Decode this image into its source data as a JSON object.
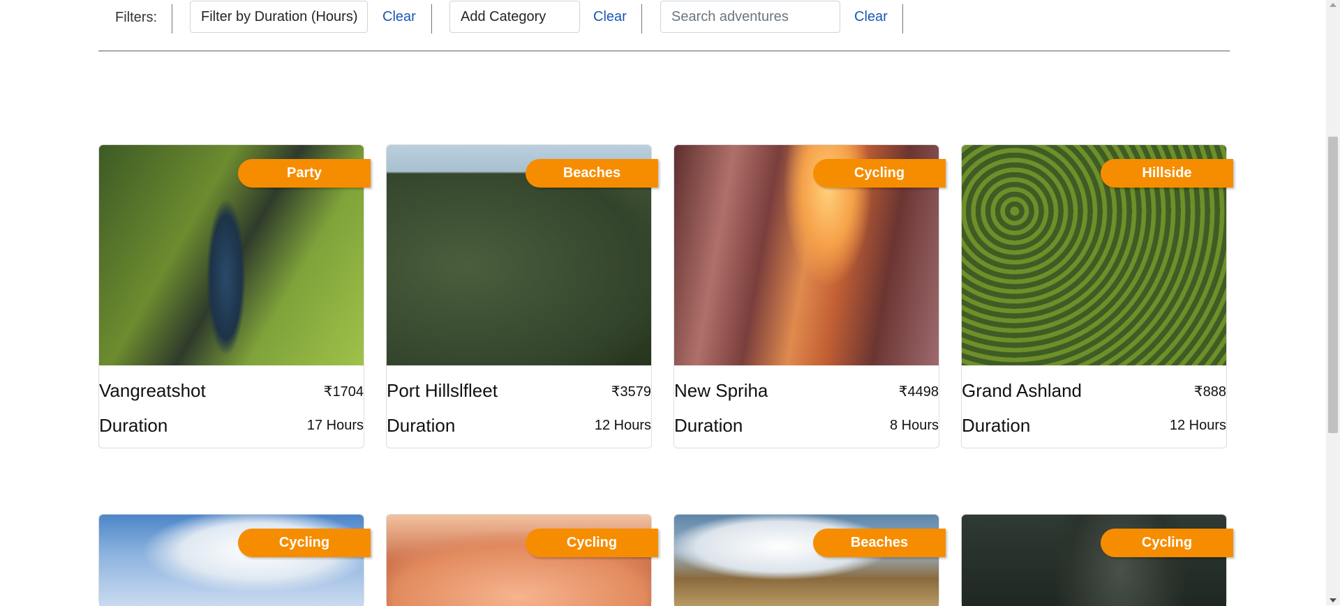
{
  "filters": {
    "label": "Filters:",
    "duration_select": "Filter by Duration (Hours)",
    "category_select": "Add Category",
    "search_placeholder": "Search adventures",
    "clear_label": "Clear"
  },
  "adventures": [
    {
      "category": "Party",
      "name": "Vangreatshot",
      "price": "₹1704",
      "duration_label": "Duration",
      "duration": "17 Hours"
    },
    {
      "category": "Beaches",
      "name": "Port Hillslfleet",
      "price": "₹3579",
      "duration_label": "Duration",
      "duration": "12 Hours"
    },
    {
      "category": "Cycling",
      "name": "New Spriha",
      "price": "₹4498",
      "duration_label": "Duration",
      "duration": "8 Hours"
    },
    {
      "category": "Hillside",
      "name": "Grand Ashland",
      "price": "₹888",
      "duration_label": "Duration",
      "duration": "12 Hours"
    },
    {
      "category": "Cycling"
    },
    {
      "category": "Cycling"
    },
    {
      "category": "Beaches"
    },
    {
      "category": "Cycling"
    }
  ],
  "colors": {
    "banner": "#f68d00",
    "link": "#1a56b5"
  }
}
